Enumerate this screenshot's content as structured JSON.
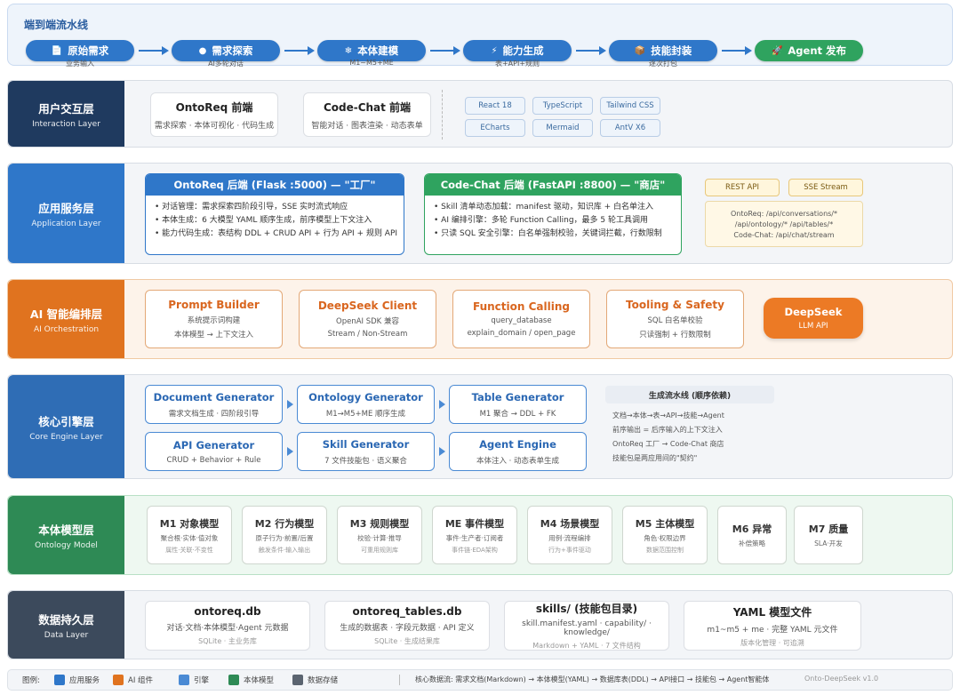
{
  "pipeline": {
    "title": "端到端流水线",
    "steps": [
      {
        "label": "原始需求",
        "sub": "业务输入",
        "icon": "📄"
      },
      {
        "label": "需求探索",
        "sub": "AI多轮对话",
        "icon": "●"
      },
      {
        "label": "本体建模",
        "sub": "M1~M5+ME",
        "icon": "❄"
      },
      {
        "label": "能力生成",
        "sub": "表+API+规则",
        "icon": "⚡"
      },
      {
        "label": "技能封装",
        "sub": "逐次打包",
        "icon": "📦"
      },
      {
        "label": "Agent 发布",
        "sub": "",
        "icon": "🚀"
      }
    ]
  },
  "layers": {
    "interaction": {
      "zh": "用户交互层",
      "en": "Interaction Layer",
      "color": "#1f3a5f"
    },
    "application": {
      "zh": "应用服务层",
      "en": "Application Layer",
      "color": "#2f77c9"
    },
    "ai": {
      "zh": "AI 智能编排层",
      "en": "AI Orchestration",
      "color": "#e0731f"
    },
    "engine": {
      "zh": "核心引擎层",
      "en": "Core Engine Layer",
      "color": "#2f6db5"
    },
    "ontology": {
      "zh": "本体模型层",
      "en": "Ontology Model",
      "color": "#2e8a55"
    },
    "data": {
      "zh": "数据持久层",
      "en": "Data Layer",
      "color": "#3c4a5c"
    }
  },
  "interaction": {
    "cards": [
      {
        "title": "OntoReq 前端",
        "sub": "需求探索 · 本体可视化 · 代码生成"
      },
      {
        "title": "Code-Chat 前端",
        "sub": "智能对话 · 图表渲染 · 动态表单"
      }
    ],
    "tech": [
      "React 18",
      "TypeScript",
      "Tailwind CSS",
      "ECharts",
      "Mermaid",
      "AntV X6"
    ]
  },
  "application": {
    "ontoreq": {
      "title": "OntoReq 后端 (Flask :5000) — \"工厂\"",
      "items": [
        "• 对话管理：需求探索四阶段引导，SSE 实时流式响应",
        "• 本体生成：6 大模型 YAML 顺序生成，前序模型上下文注入",
        "• 能力代码生成：表结构 DDL + CRUD API + 行为 API + 规则 API"
      ]
    },
    "codechat": {
      "title": "Code-Chat 后端 (FastAPI :8800) — \"商店\"",
      "items": [
        "• Skill 清单动态加载：manifest 驱动，知识库 + 白名单注入",
        "• AI 编排引擎：多轮 Function Calling，最多 5 轮工具调用",
        "• 只读 SQL 安全引擎：白名单强制校验，关键词拦截，行数限制"
      ]
    },
    "tags": [
      "REST API",
      "SSE Stream"
    ],
    "endpoints": [
      "OntoReq: /api/conversations/*",
      "/api/ontology/* /api/tables/*",
      "Code-Chat: /api/chat/stream"
    ]
  },
  "ai": {
    "cards": [
      {
        "title": "Prompt Builder",
        "l1": "系统提示词构建",
        "l2": "本体模型 → 上下文注入"
      },
      {
        "title": "DeepSeek Client",
        "l1": "OpenAI SDK 兼容",
        "l2": "Stream / Non-Stream"
      },
      {
        "title": "Function Calling",
        "l1": "query_database",
        "l2": "explain_domain / open_page"
      },
      {
        "title": "Tooling & Safety",
        "l1": "SQL 白名单校验",
        "l2": "只读强制 + 行数限制"
      }
    ],
    "llm": {
      "title": "DeepSeek",
      "sub": "LLM API"
    }
  },
  "engine": {
    "cards": [
      {
        "title": "Document Generator",
        "sub": "需求文档生成 · 四阶段引导"
      },
      {
        "title": "Ontology Generator",
        "sub": "M1→M5+ME 顺序生成"
      },
      {
        "title": "Table Generator",
        "sub": "M1 聚合 → DDL + FK"
      },
      {
        "title": "API Generator",
        "sub": "CRUD + Behavior + Rule"
      },
      {
        "title": "Skill Generator",
        "sub": "7 文件技能包 · 语义聚合"
      },
      {
        "title": "Agent Engine",
        "sub": "本体注入 · 动态表单生成"
      }
    ],
    "flow": {
      "title": "生成流水线 (顺序依赖)",
      "lines": [
        "文档→本体→表→API→技能→Agent",
        "前序输出 = 后序输入的上下文注入",
        "OntoReq 工厂 → Code-Chat 商店",
        "技能包是两应用间的\"契约\""
      ]
    }
  },
  "ontology": {
    "models": [
      {
        "title": "M1 对象模型",
        "l1": "聚合根·实体·值对象",
        "l2": "属性·关联·不变性"
      },
      {
        "title": "M2 行为模型",
        "l1": "原子行为·前置/后置",
        "l2": "触发条件·输入输出"
      },
      {
        "title": "M3 规则模型",
        "l1": "校验·计算·推导",
        "l2": "可重用规则库"
      },
      {
        "title": "ME 事件模型",
        "l1": "事件·生产者·订阅者",
        "l2": "事件链·EDA架构"
      },
      {
        "title": "M4 场景模型",
        "l1": "用例·流程编排",
        "l2": "行为+事件驱动"
      },
      {
        "title": "M5 主体模型",
        "l1": "角色·权限边界",
        "l2": "数据范围控制"
      },
      {
        "title": "M6 异常",
        "l1": "补偿策略",
        "l2": ""
      },
      {
        "title": "M7 质量",
        "l1": "SLA·开发",
        "l2": ""
      }
    ]
  },
  "data": {
    "cards": [
      {
        "title": "ontoreq.db",
        "sub": "对话·文档·本体模型·Agent 元数据",
        "s2": "SQLite · 主业务库"
      },
      {
        "title": "ontoreq_tables.db",
        "sub": "生成的数据表 · 字段元数据 · API 定义",
        "s2": "SQLite · 生成结果库"
      },
      {
        "title": "skills/ (技能包目录)",
        "sub": "skill.manifest.yaml · capability/ · knowledge/",
        "s2": "Markdown + YAML · 7 文件结构"
      },
      {
        "title": "YAML 模型文件",
        "sub": "m1~m5 + me · 完整 YAML 元文件",
        "s2": "版本化管理 · 可追溯"
      }
    ]
  },
  "legend": {
    "label": "图例:",
    "items": [
      {
        "label": "应用服务",
        "color": "#2f77c9"
      },
      {
        "label": "AI 组件",
        "color": "#e0731f"
      },
      {
        "label": "引擎",
        "color": "#4a8ad4"
      },
      {
        "label": "本体模型",
        "color": "#2e8a55"
      },
      {
        "label": "数据存储",
        "color": "#5b6470"
      }
    ],
    "flow": "核心数据流: 需求文档(Markdown) → 本体模型(YAML) → 数据库表(DDL) → API接口 → 技能包 → Agent智能体",
    "version": "Onto-DeepSeek v1.0"
  }
}
